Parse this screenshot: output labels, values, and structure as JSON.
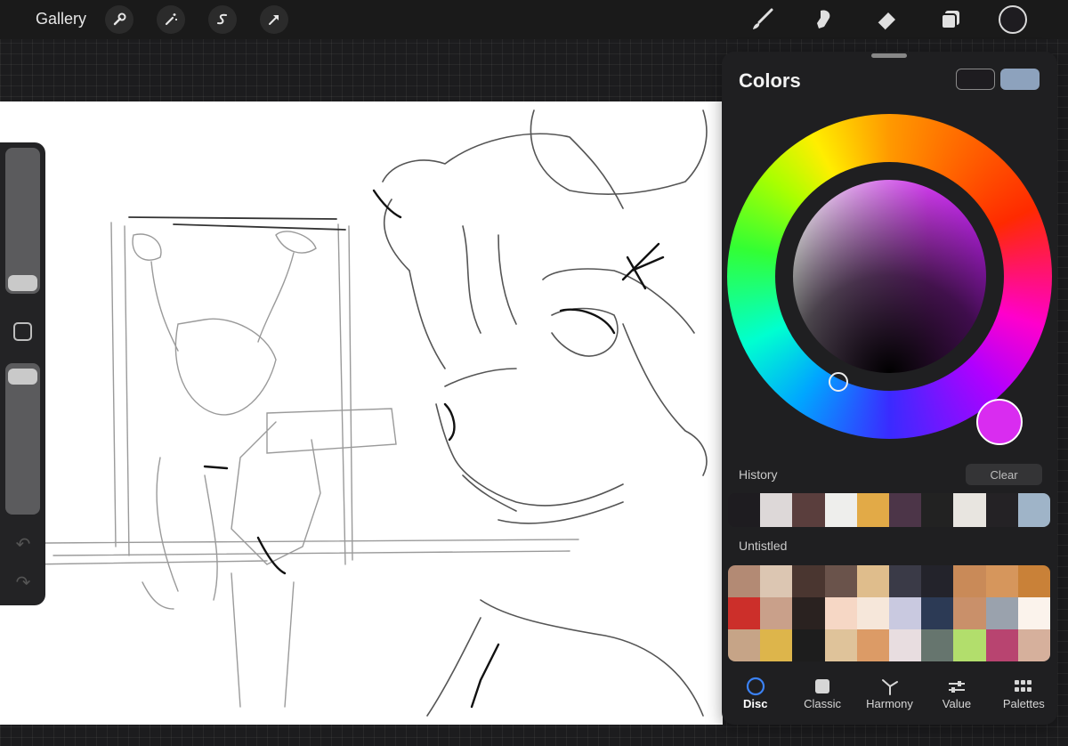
{
  "topbar": {
    "gallery_label": "Gallery",
    "left_tools": [
      "wrench-icon",
      "magic-wand-icon",
      "selection-s-icon",
      "transform-arrow-icon"
    ],
    "right_tools": [
      "brush-icon",
      "smudge-icon",
      "eraser-icon",
      "layers-icon"
    ],
    "current_color": "#1e1c20"
  },
  "sidebar": {
    "size_slider_level": 0.9,
    "opacity_slider_level": 0.05,
    "modify_label": "",
    "icons": [
      "undo-icon",
      "redo-icon"
    ]
  },
  "colors_panel": {
    "title": "Colors",
    "secondary_color": "#1e1c20",
    "primary_color": "#8da2bd",
    "selected_hue_color": "#d92cf0",
    "history_label": "History",
    "clear_label": "Clear",
    "history": [
      "#1e1c20",
      "#ddd8d8",
      "#5a3e3d",
      "#eeeeec",
      "#e2aa47",
      "#4c3548",
      "#222222",
      "#e8e5e0",
      "#242225",
      "#9fb4c8"
    ],
    "palette_label": "Untistled",
    "palette": [
      "#b38a74",
      "#dcc6b2",
      "#4a3630",
      "#6a534b",
      "#dfbd8c",
      "#3a3a47",
      "#23232b",
      "#c98a58",
      "#d6965c",
      "#c98138",
      "#cc2f2a",
      "#c9a08a",
      "#2a2220",
      "#f6d7c5",
      "#f6e7da",
      "#c9c9e0",
      "#2c3a55",
      "#c9906a",
      "#9aa2ad",
      "#fbf3ec",
      "#c6a487",
      "#ddb54b",
      "#1d1d1d",
      "#dfc39a",
      "#dc9b66",
      "#e8dde0",
      "#66756e",
      "#b2de6c",
      "#b84470",
      "#d6b09c"
    ],
    "tabs": [
      {
        "label": "Disc",
        "icon": "disc-icon",
        "active": true
      },
      {
        "label": "Classic",
        "icon": "classic-square-icon",
        "active": false
      },
      {
        "label": "Harmony",
        "icon": "harmony-icon",
        "active": false
      },
      {
        "label": "Value",
        "icon": "sliders-icon",
        "active": false
      },
      {
        "label": "Palettes",
        "icon": "palettes-grid-icon",
        "active": false
      }
    ]
  }
}
